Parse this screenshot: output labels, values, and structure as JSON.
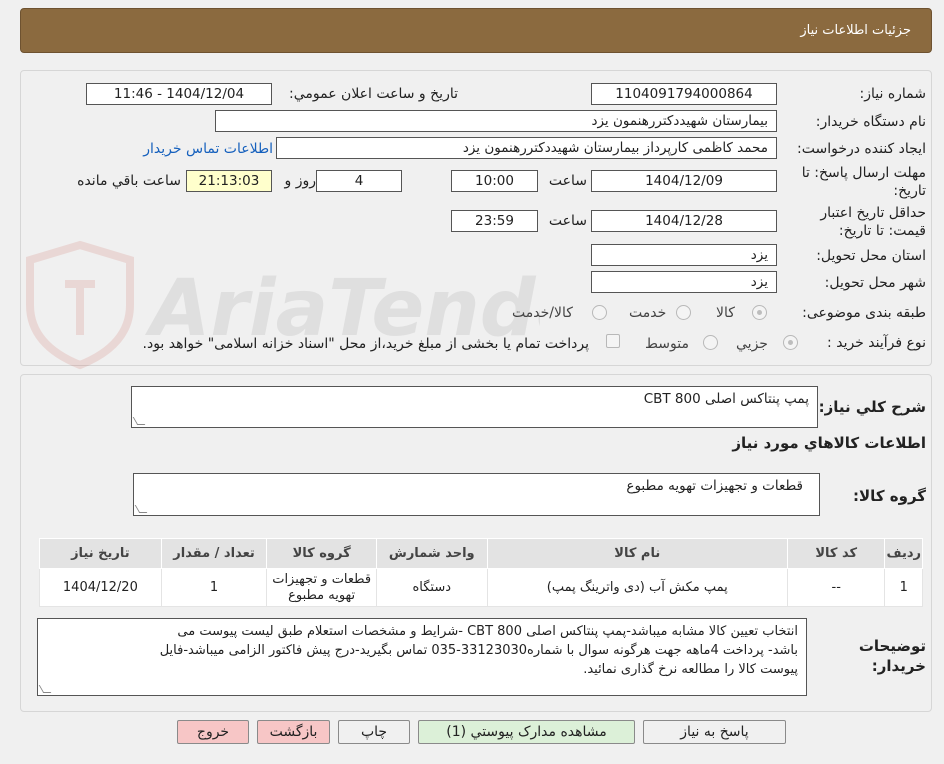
{
  "window": {
    "title": "جزئیات اطلاعات نیاز"
  },
  "watermark": {
    "text": "AriaTender.neT"
  },
  "form": {
    "need_number": {
      "label": "شماره نیاز:",
      "value": "1104091794000864"
    },
    "announce": {
      "label": "تاریخ و ساعت اعلان عمومي:",
      "value": "1404/12/04 - 11:46"
    },
    "buyer_org": {
      "label": "نام دستگاه خريدار:",
      "value": "بيمارستان شهيددکتررهنمون يزد"
    },
    "requester": {
      "label": "ايجاد کننده درخواست:",
      "value": "محمد کاظمی کارپرداز بیمارستان شهیددکتررهنمون یزد"
    },
    "buyer_contact_link": "اطلاعات تماس خريدار",
    "reply_deadline": {
      "label_line1": "مهلت ارسال پاسخ: تا",
      "label_line2": "تاريخ:",
      "date": "1404/12/09",
      "time_label": "ساعت",
      "time": "10:00",
      "days": "4",
      "days_label": "روز و",
      "remaining": "21:13:03",
      "remaining_label": "ساعت باقي مانده"
    },
    "price_validity": {
      "label_line1": "حداقل تاريخ اعتبار",
      "label_line2": "قيمت: تا تاريخ:",
      "date": "1404/12/28",
      "time_label": "ساعت",
      "time": "23:59"
    },
    "province": {
      "label": "استان محل تحويل:",
      "value": "يزد"
    },
    "city": {
      "label": "شهر محل تحويل:",
      "value": "يزد"
    },
    "category": {
      "label": "طبقه بندی موضوعی:",
      "options": [
        "کالا",
        "خدمت",
        "کالا/خدمت"
      ]
    },
    "process_type": {
      "label": "نوع فرآيند خريد :",
      "options": [
        "جزيي",
        "متوسط"
      ],
      "payment_note": "پرداخت تمام يا بخشی از مبلغ خريد،از محل \"اسناد خزانه اسلامی\" خواهد بود."
    }
  },
  "summary": {
    "label": "شرح کلي نياز:",
    "value": "پمپ پنتاکس اصلی  CBT 800"
  },
  "goods_info": {
    "heading": "اطلاعات کالاهاي مورد نياز",
    "group_label": "گروه کالا:",
    "group_value": "قطعات و تجهيزات تهويه مطبوع"
  },
  "table": {
    "headers": [
      "رديف",
      "کد کالا",
      "نام کالا",
      "واحد شمارش",
      "گروه کالا",
      "تعداد / مقدار",
      "تاريخ نياز"
    ],
    "rows": [
      [
        "1",
        "--",
        "پمپ مکش آب (دی واترينگ پمپ)",
        "دستگاه",
        "قطعات و تجهيزات تهويه مطبوع",
        "1",
        "1404/12/20"
      ]
    ]
  },
  "buyer_notes": {
    "label_line1": "توضيحات",
    "label_line2": "خريدار:",
    "lines": [
      "انتخاب تعيين کالا مشابه ميباشد-پمپ پنتاکس اصلی  CBT 800 -شرايط و مشخصات استعلام طبق ليست پيوست می",
      "باشد- پرداخت 4ماهه جهت هرگونه سوال با شماره33123030-035 تماس بگيريد-درج پيش فاکتور الزامی ميباشد-فايل",
      "پيوست کالا را مطالعه نرخ گذاری نمائيد."
    ]
  },
  "buttons": {
    "reply": "پاسخ به نياز",
    "attachments": "مشاهده مدارک پيوستي (1)",
    "print": "چاپ",
    "back": "بازگشت",
    "exit": "خروج"
  }
}
